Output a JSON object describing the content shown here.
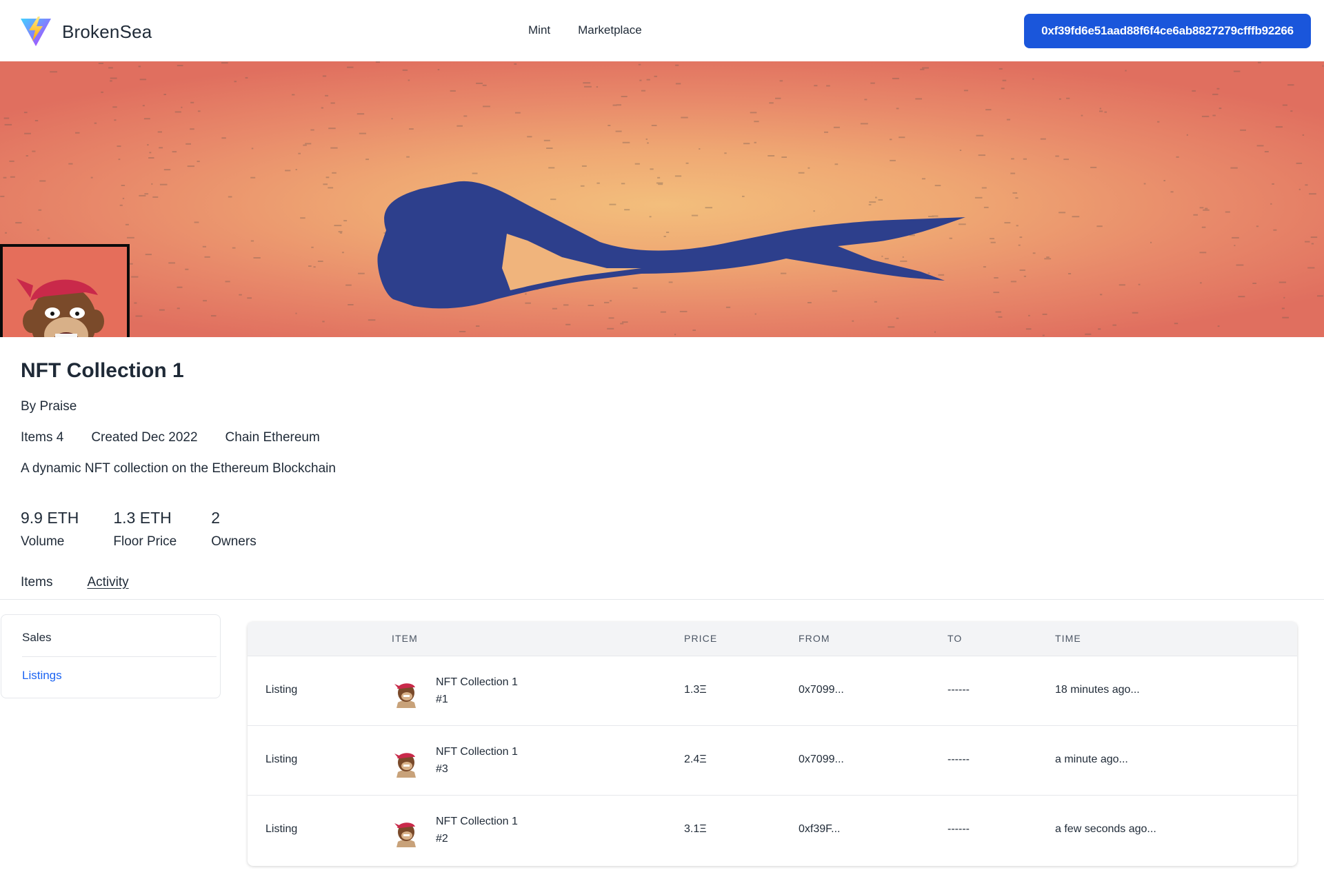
{
  "brand": {
    "name": "BrokenSea",
    "logo_icon": "vite-lightning-logo-icon"
  },
  "nav": {
    "mint": "Mint",
    "marketplace": "Marketplace"
  },
  "wallet": {
    "address": "0xf39fd6e51aad88f6f4ce6ab8827279cfffb92266"
  },
  "colors": {
    "accent": "#1a56db",
    "link": "#1c64f2",
    "banner_ribbon": "#2e3f8c",
    "banner_bg": "#e8896a"
  },
  "collection": {
    "title": "NFT Collection 1",
    "by": "By Praise",
    "items": "Items 4",
    "created": "Created Dec 2022",
    "chain": "Chain Ethereum",
    "description": "A dynamic NFT collection on the Ethereum Blockchain"
  },
  "stats": [
    {
      "value": "9.9 ETH",
      "label": "Volume"
    },
    {
      "value": "1.3 ETH",
      "label": "Floor Price"
    },
    {
      "value": "2",
      "label": "Owners"
    }
  ],
  "tabs": {
    "items": "Items",
    "activity": "Activity",
    "active": "Activity"
  },
  "filters": {
    "sales": "Sales",
    "listings": "Listings",
    "active": "Listings"
  },
  "table": {
    "headers": {
      "item": "ITEM",
      "price": "PRICE",
      "from": "FROM",
      "to": "TO",
      "time": "TIME"
    },
    "rows": [
      {
        "event": "Listing",
        "name": "NFT Collection 1",
        "token": "#1",
        "price": "1.3Ξ",
        "from": "0x7099...",
        "to": "------",
        "time": "18 minutes ago..."
      },
      {
        "event": "Listing",
        "name": "NFT Collection 1",
        "token": "#3",
        "price": "2.4Ξ",
        "from": "0x7099...",
        "to": "------",
        "time": "a minute ago..."
      },
      {
        "event": "Listing",
        "name": "NFT Collection 1",
        "token": "#2",
        "price": "3.1Ξ",
        "from": "0xf39F...",
        "to": "------",
        "time": "a few seconds ago..."
      }
    ]
  }
}
